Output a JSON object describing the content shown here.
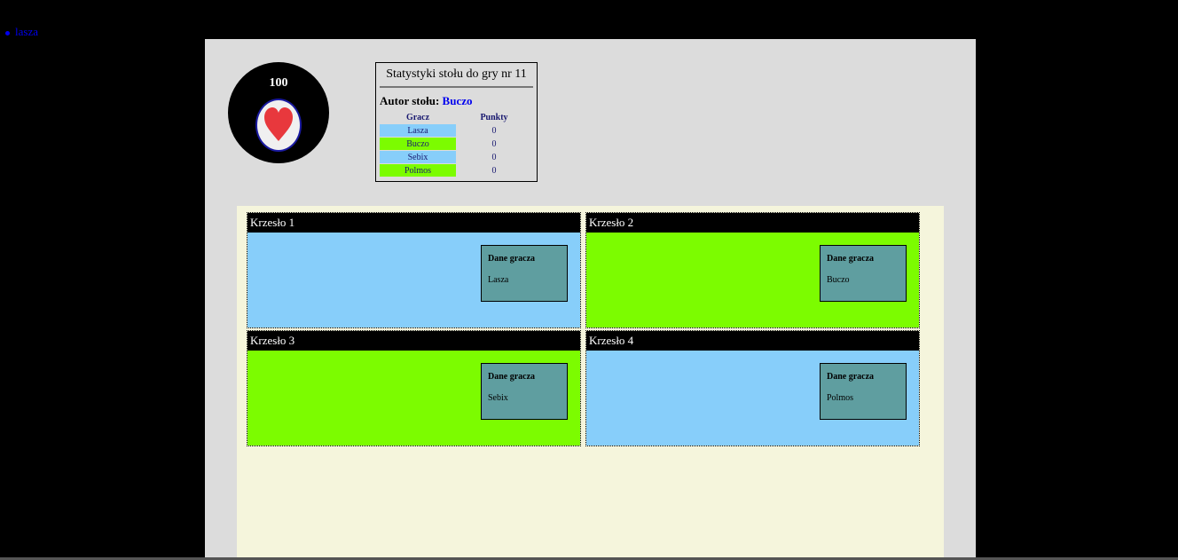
{
  "user": {
    "name": "lasza",
    "color": "#0000ee"
  },
  "chip": {
    "value": "100",
    "suit": "heart",
    "suit_color": "#e8383d"
  },
  "stats": {
    "title": "Statystyki stołu do gry nr 11",
    "author_label": "Autor stołu:",
    "author_name": "Buczo",
    "col_player": "Gracz",
    "col_points": "Punkty",
    "rows": [
      {
        "player": "Lasza",
        "points": "0",
        "color": "#87cefa"
      },
      {
        "player": "Buczo",
        "points": "0",
        "color": "#7cfc00"
      },
      {
        "player": "Sebix",
        "points": "0",
        "color": "#87cefa"
      },
      {
        "player": "Polmos",
        "points": "0",
        "color": "#7cfc00"
      }
    ]
  },
  "seats": [
    {
      "label": "Krzesło 1",
      "info_title": "Dane gracza",
      "player": "Lasza",
      "color": "#87cefa"
    },
    {
      "label": "Krzesło 2",
      "info_title": "Dane gracza",
      "player": "Buczo",
      "color": "#7cfc00"
    },
    {
      "label": "Krzesło 3",
      "info_title": "Dane gracza",
      "player": "Sebix",
      "color": "#7cfc00"
    },
    {
      "label": "Krzesło 4",
      "info_title": "Dane gracza",
      "player": "Polmos",
      "color": "#87cefa"
    }
  ]
}
